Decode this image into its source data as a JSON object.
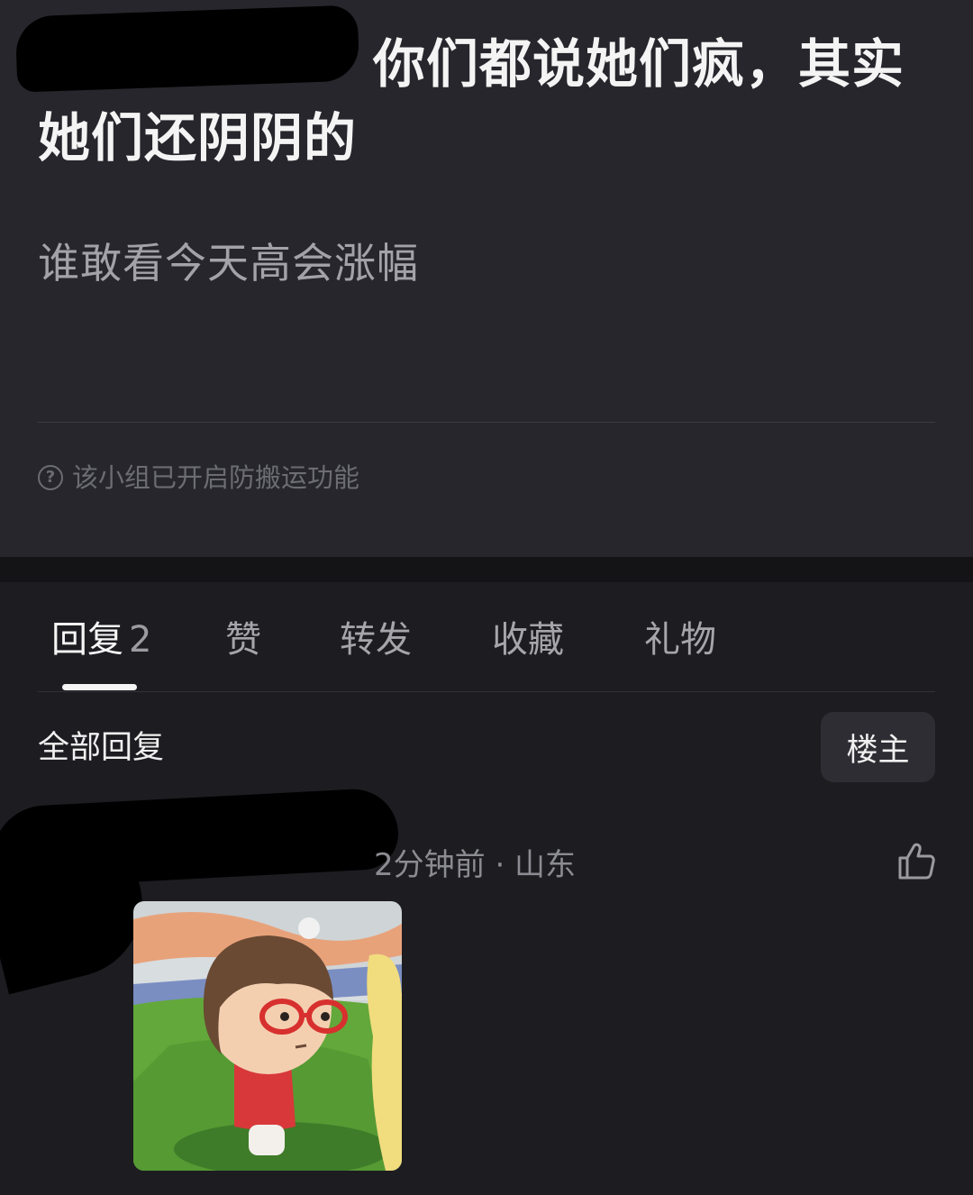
{
  "post": {
    "title": "你们都说她们疯，其实她们还阴阴的",
    "body": "谁敢看今天高会涨幅",
    "notice": "该小组已开启防搬运功能",
    "notice_icon": "question-circle-icon"
  },
  "tabs": [
    {
      "label": "回复",
      "count": "2",
      "active": true
    },
    {
      "label": "赞",
      "active": false
    },
    {
      "label": "转发",
      "active": false
    },
    {
      "label": "收藏",
      "active": false
    },
    {
      "label": "礼物",
      "active": false
    }
  ],
  "replies_section": {
    "label": "全部回复",
    "op_button": "楼主"
  },
  "reply": {
    "meta": "2分钟前 · 山东",
    "like_icon": "thumbs-up-icon",
    "image": "cartoon-girl-with-red-glasses-sticker"
  },
  "colors": {
    "post_background": "#26262c",
    "page_background": "#1c1c21",
    "active_tab": "#f6f6f6",
    "inactive_tab": "#a5a5ab"
  }
}
